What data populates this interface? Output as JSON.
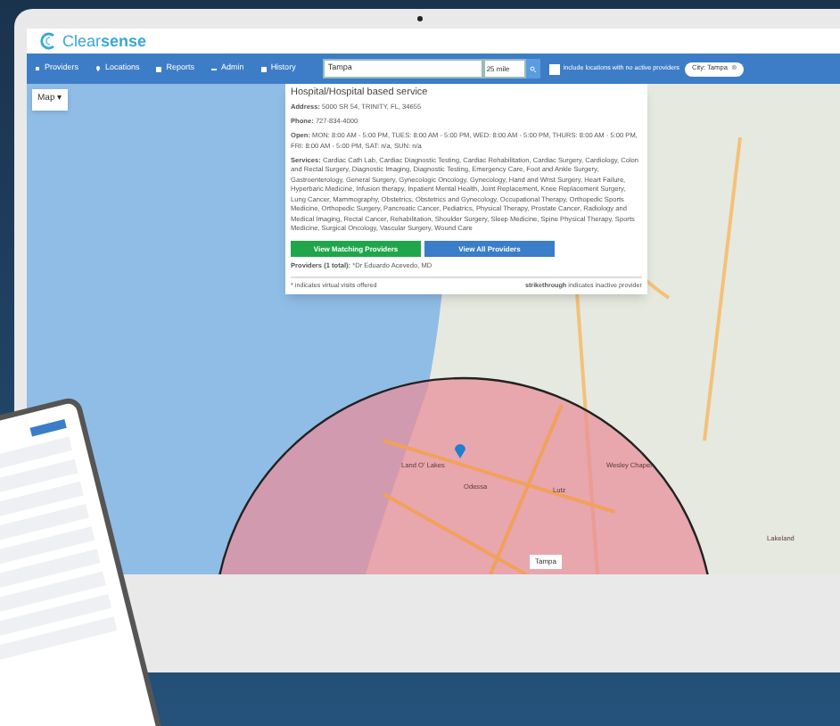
{
  "header": {
    "logo_text": "Clear**sense**"
  },
  "nav": {
    "items": [
      {
        "label": "Providers"
      },
      {
        "label": "Locations"
      },
      {
        "label": "Reports"
      },
      {
        "label": "Admin"
      },
      {
        "label": "History"
      }
    ],
    "search": {
      "value": "Tampa"
    },
    "radius": {
      "value": "25 mile"
    },
    "include_inactive": {
      "label": "include locations with no active providers",
      "checked": false
    },
    "filter_chip": {
      "label": "City: Tampa",
      "remove_icon": "⊗"
    }
  },
  "map": {
    "map_button": "Map ▾",
    "labels": [
      "Land O' Lakes",
      "Odessa",
      "Lutz",
      "Wesley Chapel",
      "Lakeland"
    ],
    "search_label": "Tampa"
  },
  "popup": {
    "title": "Hospital/Hospital based service",
    "fields": [
      {
        "label": "Address:",
        "value": "5000 SR 54, TRINITY, FL, 34655"
      },
      {
        "label": "Phone:",
        "value": "727-834-4000"
      },
      {
        "label": "Open:",
        "value": "MON: 8:00 AM - 5:00 PM, TUES: 8:00 AM - 5:00 PM, WED: 8:00 AM - 5:00 PM, THURS: 8:00 AM - 5:00 PM, FRI: 8:00 AM - 5:00 PM, SAT: n/a, SUN: n/a"
      },
      {
        "label": "Services:",
        "value": "Cardiac Cath Lab, Cardiac Diagnostic Testing, Cardiac Rehabilitation, Cardiac Surgery, Cardiology, Colon and Rectal Surgery, Diagnostic Imaging, Diagnostic Testing, Emergency Care, Foot and Ankle Surgery, Gastroenterology, General Surgery, Gynecologic Oncology, Gynecology, Hand and Wrist Surgery, Heart Failure, Hyperbaric Medicine, Infusion therapy, Inpatient Mental Health, Joint Replacement, Knee Replacement Surgery, Lung Cancer, Mammography, Obstetrics, Obstetrics and Gynecology, Occupational Therapy, Orthopedic Sports Medicine, Orthopedic Surgery, Pancreatic Cancer, Pediatrics, Physical Therapy, Prostate Cancer, Radiology and Medical Imaging, Rectal Cancer, Rehabilitation, Shoulder Surgery, Sleep Medicine, Spine Physical Therapy, Sports Medicine, Surgical Oncology, Vascular Surgery, Wound Care"
      }
    ],
    "buttons": [
      {
        "label": "View Matching Providers",
        "kind": "green"
      },
      {
        "label": "View All Providers",
        "kind": "blue"
      }
    ],
    "providers": {
      "label": "Providers (1 total):",
      "value": "*Dr Eduardo Acevedo, MD"
    },
    "footnote_left": "* indicates virtual visits offered",
    "footnote_right": "**strikethrough** indicates inactive provider"
  }
}
